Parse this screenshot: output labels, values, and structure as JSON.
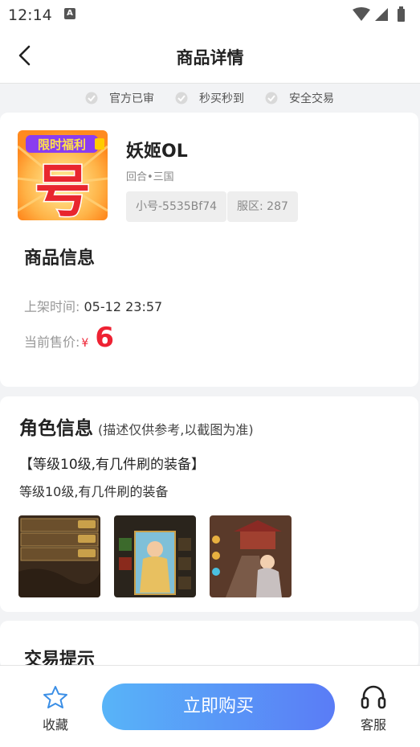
{
  "status_bar": {
    "time": "12:14",
    "notification_icon": "a-badge-icon"
  },
  "header": {
    "title": "商品详情",
    "back_icon": "chevron-left-icon"
  },
  "trust_badges": [
    {
      "label": "官方已审",
      "icon": "check-circle-icon"
    },
    {
      "label": "秒买秒到",
      "icon": "check-circle-icon"
    },
    {
      "label": "安全交易",
      "icon": "check-circle-icon"
    }
  ],
  "game": {
    "name": "妖姬OL",
    "type": "回合•三国",
    "tags": [
      "小号-5535Bf74",
      "服区: 287"
    ],
    "icon_text": {
      "banner": "限时福利",
      "big_char": "号"
    }
  },
  "product_info": {
    "title": "商品信息",
    "listed_label": "上架时间:",
    "listed_value": "05-12 23:57",
    "price_label": "当前售价:",
    "currency": "¥",
    "price": "6"
  },
  "role_info": {
    "title": "角色信息",
    "note": "(描述仅供参考,以截图为准)",
    "headline": "【等级10级,有几件刷的装备】",
    "description": "等级10级,有几件刷的装备"
  },
  "trade_tips": {
    "title": "交易提示"
  },
  "bottom_bar": {
    "favorite_label": "收藏",
    "buy_label": "立即购买",
    "service_label": "客服"
  },
  "colors": {
    "accent_price": "#ee2233",
    "buy_gradient_start": "#58b4f8",
    "buy_gradient_end": "#5a7cf6",
    "star": "#3a8ee6"
  }
}
